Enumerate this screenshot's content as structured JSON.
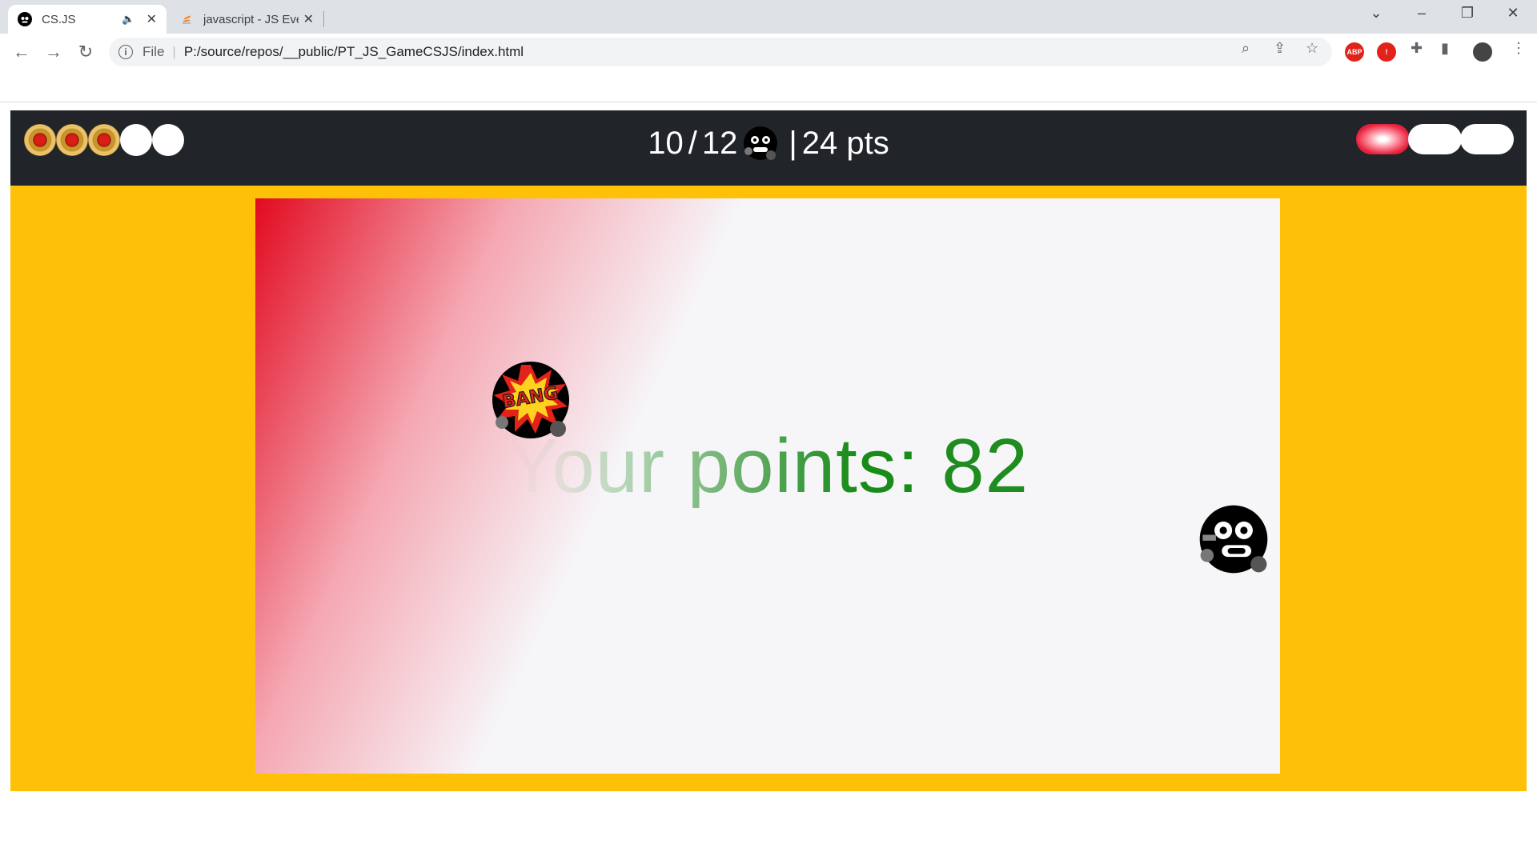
{
  "browser": {
    "tabs": [
      {
        "title": "CS.JS",
        "active": true
      },
      {
        "title": "javascript - JS Eve",
        "active": false
      }
    ],
    "file_label": "File",
    "url": "P:/source/repos/__public/PT_JS_GameCSJS/index.html",
    "extensions": [
      "ABP"
    ]
  },
  "hud": {
    "shots_fired": "10",
    "shots_total": "12",
    "shots_separator": "/",
    "score_separator": "|",
    "score": "24 pts",
    "bullets": {
      "full": 3,
      "empty": 2
    },
    "lives": {
      "lost": 1,
      "remaining": 2
    }
  },
  "field": {
    "points_label": "Your points: ",
    "points_value": "82",
    "bang_text": "BANG"
  },
  "colors": {
    "hud_bg": "#212529",
    "game_bg": "#ffc107",
    "points_green": "#1e8c1e",
    "gradient_red": "#e20a20"
  }
}
